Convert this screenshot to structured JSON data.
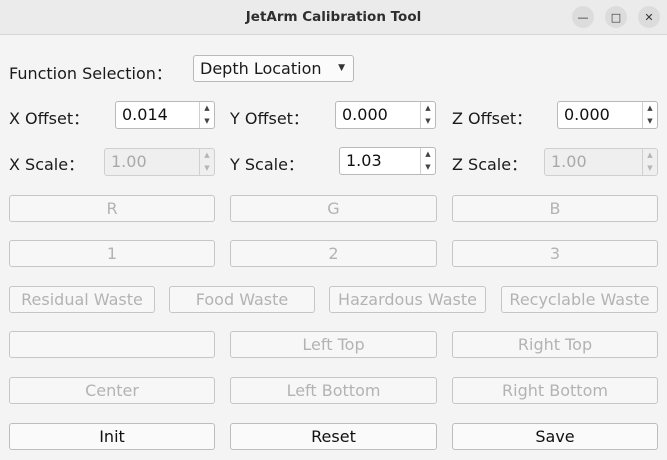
{
  "window": {
    "title": "JetArm Calibration Tool",
    "minimize_glyph": "—",
    "maximize_glyph": "□",
    "close_glyph": "✕"
  },
  "function_selection": {
    "label": "Function Selection：",
    "selected": "Depth Location"
  },
  "offsets": {
    "x_label": "X Offset：",
    "x_value": "0.014",
    "y_label": "Y Offset：",
    "y_value": "0.000",
    "z_label": "Z Offset：",
    "z_value": "0.000"
  },
  "scales": {
    "x_label": "X Scale：",
    "x_value": "1.00",
    "y_label": "Y Scale：",
    "y_value": "1.03",
    "z_label": "Z Scale：",
    "z_value": "1.00"
  },
  "color_buttons": {
    "r": "R",
    "g": "G",
    "b": "B"
  },
  "number_buttons": {
    "one": "1",
    "two": "2",
    "three": "3"
  },
  "waste_buttons": {
    "residual": "Residual Waste",
    "food": "Food Waste",
    "hazardous": "Hazardous Waste",
    "recyclable": "Recyclable Waste"
  },
  "position_buttons": {
    "blank": "",
    "left_top": "Left Top",
    "right_top": "Right Top",
    "center": "Center",
    "left_bottom": "Left Bottom",
    "right_bottom": "Right Bottom"
  },
  "action_buttons": {
    "init": "Init",
    "reset": "Reset",
    "save": "Save"
  },
  "icons": {
    "spin_up": "▲",
    "spin_down": "▼",
    "dropdown": "▼"
  }
}
